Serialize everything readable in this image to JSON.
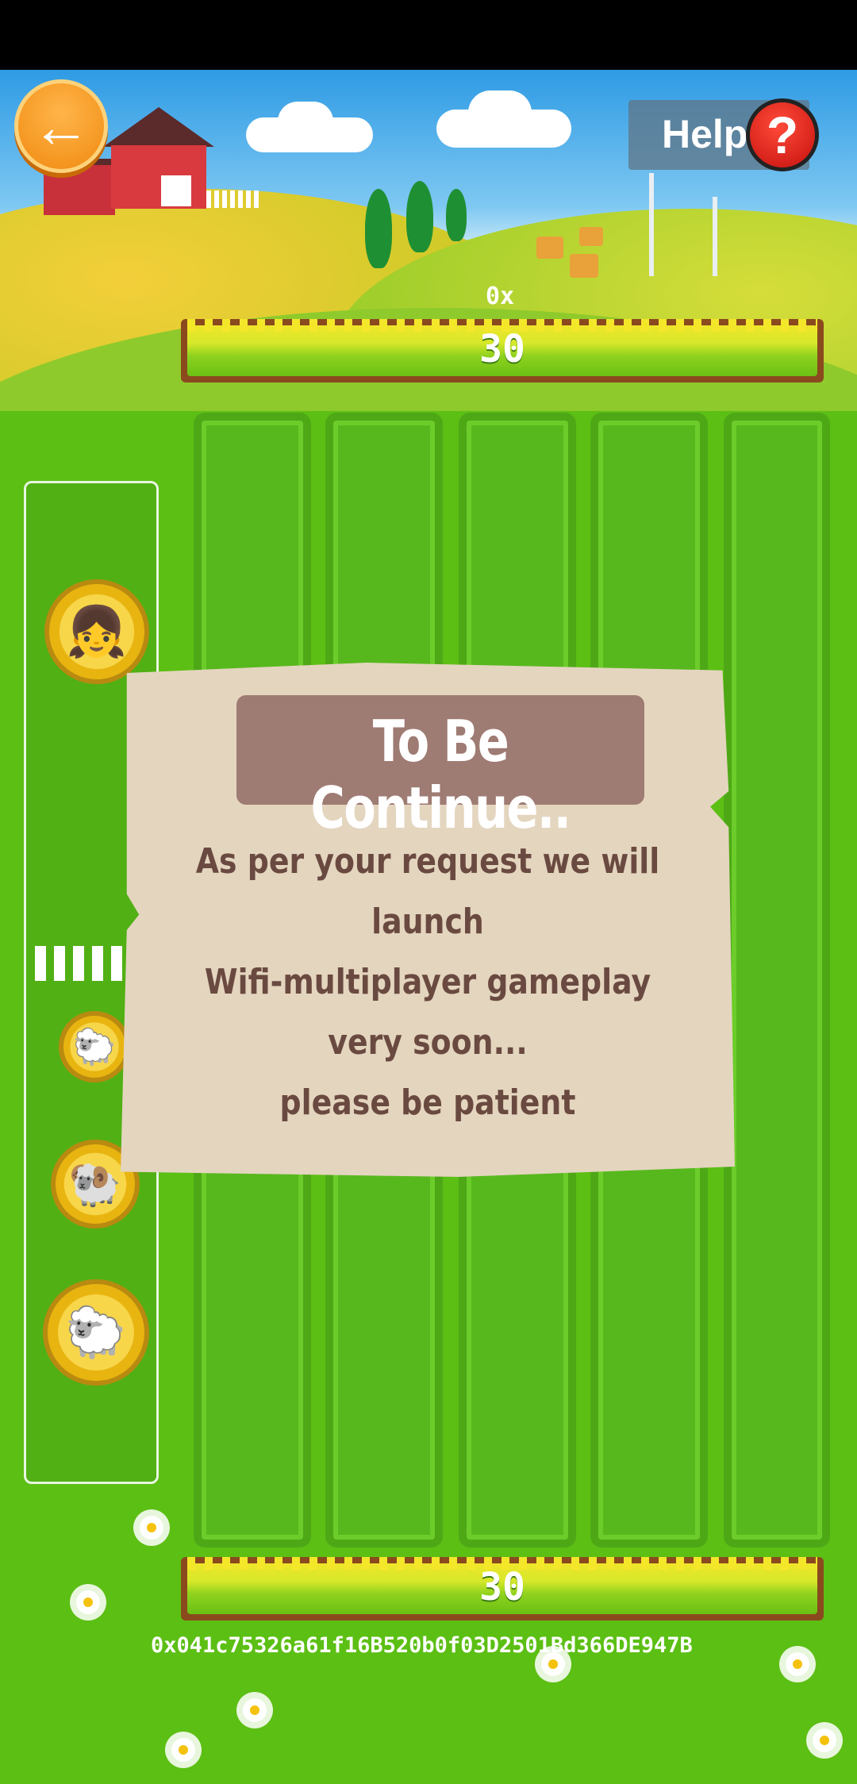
{
  "header": {
    "back_icon": "arrow-left-icon",
    "help_label": "Help",
    "help_icon_glyph": "?",
    "multiplier": "0x",
    "top_score": "30"
  },
  "side_panel": {
    "players": [
      "farmer-girl-icon",
      "sheep-icon",
      "ram-icon",
      "lamb-icon"
    ]
  },
  "dialog": {
    "title": "To Be Continue..",
    "line1": "As per your request we will launch",
    "line2": "Wifi-multiplayer gameplay very soon...",
    "line3": "please be patient"
  },
  "footer": {
    "bottom_score": "30",
    "address": "0x041c75326a61f16B520b0f03D2501Bd366DE947B"
  },
  "colors": {
    "grass": "#5cbf14",
    "dialog_bg": "#e4d5bf",
    "dialog_title_bg": "#9e7b73",
    "dialog_text": "#6a4a40",
    "back_button": "#f08a10",
    "help_button": "#c5110d"
  }
}
